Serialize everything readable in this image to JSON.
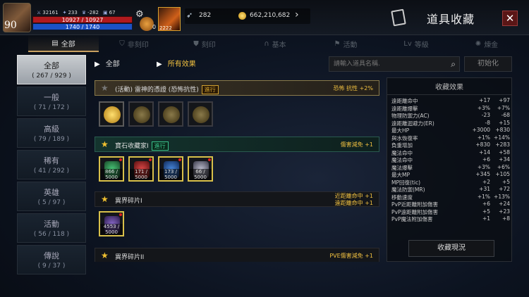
{
  "player": {
    "level": "90",
    "stat1": "32161",
    "stat2": "233",
    "stat3": "-282",
    "stat4": "67",
    "hp": "10927 / 10927",
    "mp": "1740 / 1740",
    "pouch_count": "0",
    "ability_value": "2222"
  },
  "currency": {
    "feathers": "282",
    "gold": "662,210,682"
  },
  "window": {
    "title": "道具收藏",
    "close": "✕"
  },
  "tabs": [
    {
      "label": "全部",
      "icon": "book-icon",
      "active": true
    },
    {
      "label": "非刻印",
      "icon": "shield-x-icon",
      "active": false
    },
    {
      "label": "刻印",
      "icon": "shield-icon",
      "active": false
    },
    {
      "label": "基本",
      "icon": "horseshoe-icon",
      "active": false
    },
    {
      "label": "活動",
      "icon": "flag-icon",
      "active": false
    },
    {
      "label": "等級",
      "icon": "level-icon",
      "active": false
    },
    {
      "label": "煉金",
      "icon": "alchemy-icon",
      "active": false
    }
  ],
  "categories": [
    {
      "name": "全部",
      "count": "( 267 / 929 )",
      "active": true
    },
    {
      "name": "一般",
      "count": "( 71 / 172 )",
      "active": false
    },
    {
      "name": "高級",
      "count": "( 79 / 189 )",
      "active": false
    },
    {
      "name": "稀有",
      "count": "( 41 / 292 )",
      "active": false
    },
    {
      "name": "英雄",
      "count": "( 5 / 97 )",
      "active": false
    },
    {
      "name": "活動",
      "count": "( 56 / 118 )",
      "active": false
    },
    {
      "name": "傳說",
      "count": "( 9 / 37 )",
      "active": false
    }
  ],
  "filters": {
    "scope": "全部",
    "effect": "所有效果",
    "search_placeholder": "請輸入道具名稱.",
    "reset": "初始化"
  },
  "collections": [
    {
      "name": "(活動) 雷神的憑證 (恐怖抗性)",
      "badge": "進行",
      "badge_style": "gold",
      "effect": "恐怖 抗性 +2%",
      "effect2": "",
      "starred": false,
      "slots": [
        {
          "kind": "coin",
          "count": "",
          "filled": true
        },
        {
          "kind": "coin",
          "count": "",
          "filled": false
        },
        {
          "kind": "coin",
          "count": "",
          "filled": false
        },
        {
          "kind": "coin",
          "count": "",
          "filled": false
        }
      ]
    },
    {
      "name": "寶石收藏家I",
      "badge": "進行",
      "badge_style": "green",
      "effect": "傷害減免 +1",
      "effect2": "",
      "starred": true,
      "slots": [
        {
          "kind": "gem",
          "color": "#2a8a4a",
          "count": "866 / 5000"
        },
        {
          "kind": "gem",
          "color": "#b02a2a",
          "count": "171 / 5000"
        },
        {
          "kind": "gem",
          "color": "#2a5ab0",
          "count": "173 / 5000"
        },
        {
          "kind": "gem",
          "color": "#8a8a9a",
          "count": "66 / 5000"
        }
      ]
    },
    {
      "name": "異界碎片I",
      "badge": "",
      "badge_style": "",
      "effect": "近距離命中 +1",
      "effect2": "遠距離命中 +1",
      "starred": true,
      "slots": [
        {
          "kind": "gem",
          "color": "#4a3a7a",
          "count": "4553 / 5000"
        }
      ]
    },
    {
      "name": "異界碎片II",
      "badge": "",
      "badge_style": "",
      "effect": "PVE傷害減免 +1",
      "effect2": "",
      "starred": true,
      "slots": []
    }
  ],
  "panel": {
    "title": "收藏效果",
    "stats": [
      {
        "k": "遠距離命中",
        "a": "+17",
        "b": "+97"
      },
      {
        "k": "遠距離爆擊",
        "a": "+3%",
        "b": "+7%"
      },
      {
        "k": "物理防禦力(AC)",
        "a": "-23",
        "b": "-68"
      },
      {
        "k": "遠距離迴避力(ER)",
        "a": "-8",
        "b": "+15"
      },
      {
        "k": "最大HP",
        "a": "+3000",
        "b": "+830"
      },
      {
        "k": "與水恢復率",
        "a": "+1%",
        "b": "+14%"
      },
      {
        "k": "負重增加",
        "a": "+830",
        "b": "+283"
      },
      {
        "k": "魔法命中",
        "a": "+14",
        "b": "+58"
      },
      {
        "k": "魔法命中",
        "a": "+6",
        "b": "+34"
      },
      {
        "k": "魔法爆擊",
        "a": "+3%",
        "b": "+6%"
      },
      {
        "k": "最大MP",
        "a": "+345",
        "b": "+105"
      },
      {
        "k": "MP回復(tic)",
        "a": "+2",
        "b": "+5"
      },
      {
        "k": "魔法防禦(MR)",
        "a": "+31",
        "b": "+72"
      },
      {
        "k": "移動速度",
        "a": "+1%",
        "b": "+13%"
      },
      {
        "k": "PvP近距離附加傷害",
        "a": "+6",
        "b": "+24"
      },
      {
        "k": "PvP遠距離附加傷害",
        "a": "+5",
        "b": "+23"
      },
      {
        "k": "PvP魔法附加傷害",
        "a": "+1",
        "b": "+8"
      }
    ],
    "button": "收藏現況"
  }
}
